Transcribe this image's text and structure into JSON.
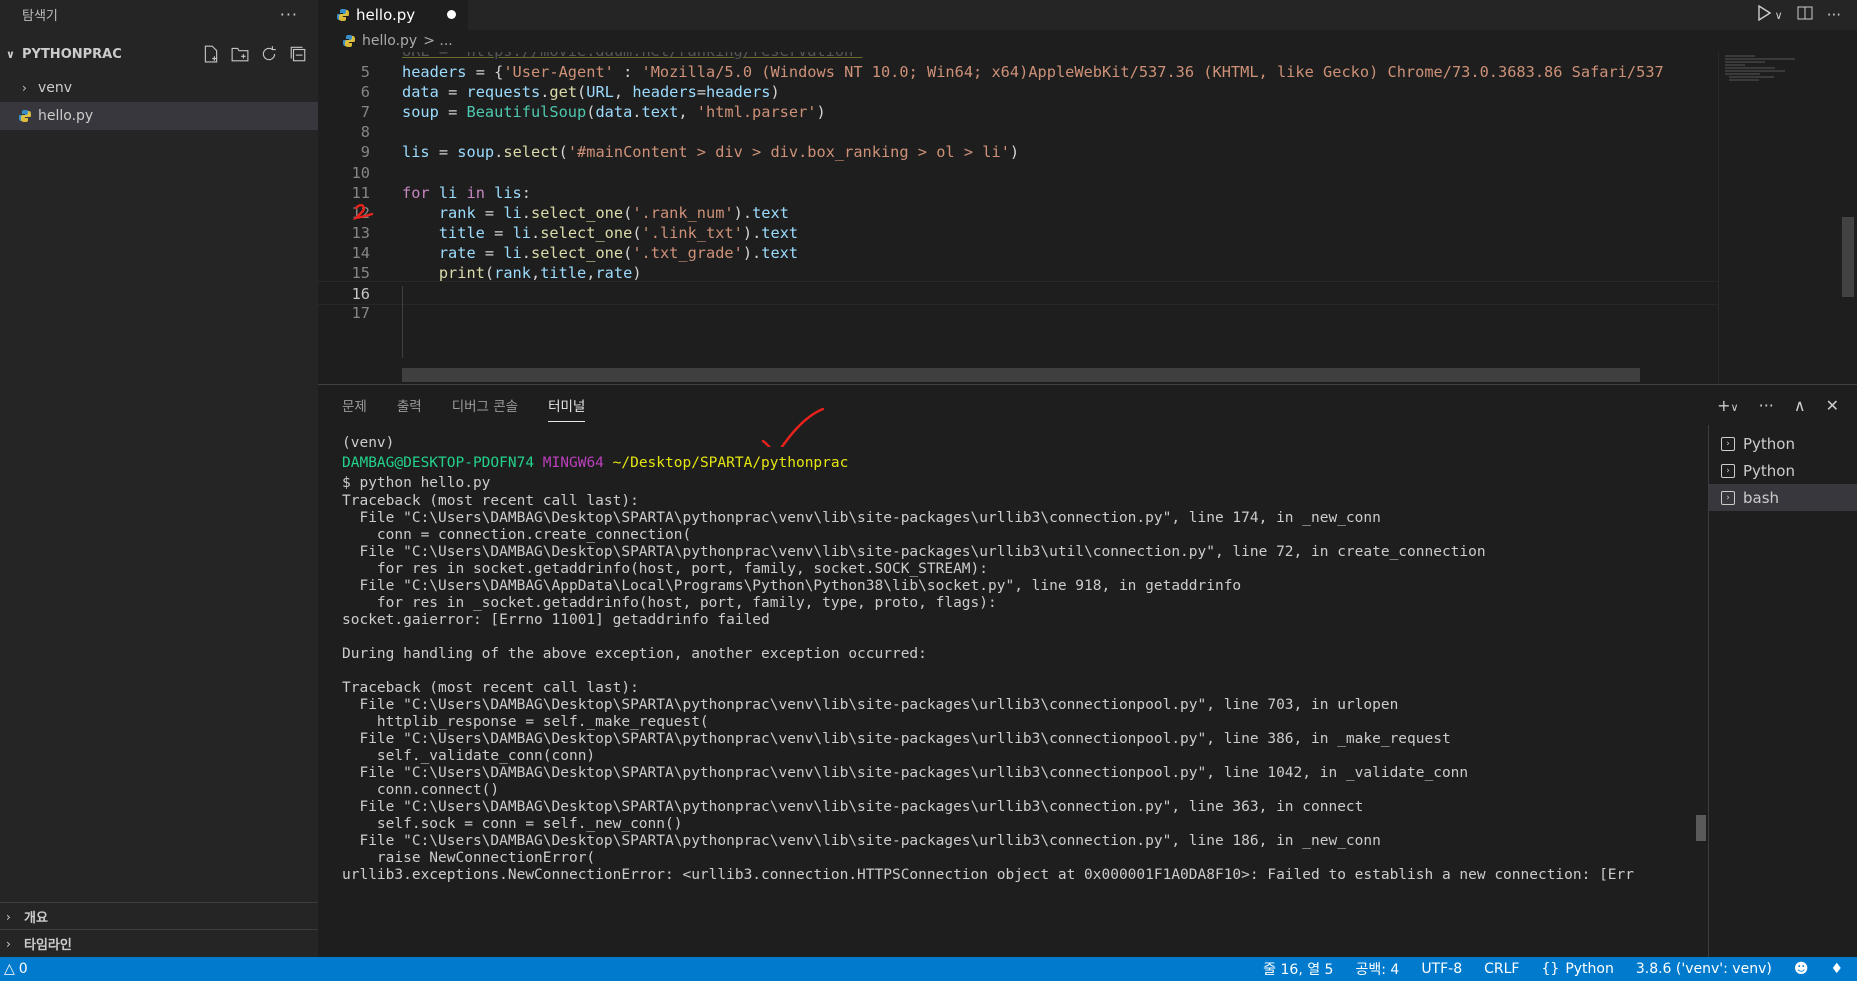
{
  "sidebar": {
    "title": "탐색기",
    "more": "···",
    "section": "PYTHONPRAC",
    "items": [
      {
        "label": "venv",
        "type": "folder"
      },
      {
        "label": "hello.py",
        "type": "file"
      }
    ],
    "bottom": [
      {
        "label": "개요"
      },
      {
        "label": "타임라인"
      }
    ]
  },
  "editor": {
    "tab": "hello.py",
    "breadcrumb_file": "hello.py",
    "breadcrumb_rest": "> ...",
    "cut_line": "URL = 'https://movie.daum.net/ranking/reservation'",
    "lines": [
      {
        "n": "5",
        "code": "headers = {'User-Agent' : 'Mozilla/5.0 (Windows NT 10.0; Win64; x64)AppleWebKit/537.36 (KHTML, like Gecko) Chrome/73.0.3683.86 Safari/537"
      },
      {
        "n": "6",
        "code": "data = requests.get(URL, headers=headers)"
      },
      {
        "n": "7",
        "code": "soup = BeautifulSoup(data.text, 'html.parser')"
      },
      {
        "n": "8",
        "code": ""
      },
      {
        "n": "9",
        "code": "lis = soup.select('#mainContent > div > div.box_ranking > ol > li')"
      },
      {
        "n": "10",
        "code": ""
      },
      {
        "n": "11",
        "code": "for li in lis:"
      },
      {
        "n": "12",
        "code": "    rank = li.select_one('.rank_num').text"
      },
      {
        "n": "13",
        "code": "    title = li.select_one('.link_txt').text"
      },
      {
        "n": "14",
        "code": "    rate = li.select_one('.txt_grade').text"
      },
      {
        "n": "15",
        "code": "    print(rank,title,rate)"
      },
      {
        "n": "16",
        "code": ""
      },
      {
        "n": "17",
        "code": ""
      }
    ]
  },
  "panel": {
    "tabs": [
      "문제",
      "출력",
      "디버그 콘솔",
      "터미널"
    ],
    "active_tab": "터미널",
    "terminal": {
      "venv": "(venv)",
      "prompt_user": "DAMBAG@DESKTOP-PDOFN74",
      "prompt_host": "MINGW64",
      "prompt_path": "~/Desktop/SPARTA/pythonprac",
      "command": "$ python hello.py",
      "output": [
        "Traceback (most recent call last):",
        "  File \"C:\\Users\\DAMBAG\\Desktop\\SPARTA\\pythonprac\\venv\\lib\\site-packages\\urllib3\\connection.py\", line 174, in _new_conn",
        "    conn = connection.create_connection(",
        "  File \"C:\\Users\\DAMBAG\\Desktop\\SPARTA\\pythonprac\\venv\\lib\\site-packages\\urllib3\\util\\connection.py\", line 72, in create_connection",
        "    for res in socket.getaddrinfo(host, port, family, socket.SOCK_STREAM):",
        "  File \"C:\\Users\\DAMBAG\\AppData\\Local\\Programs\\Python\\Python38\\lib\\socket.py\", line 918, in getaddrinfo",
        "    for res in _socket.getaddrinfo(host, port, family, type, proto, flags):",
        "socket.gaierror: [Errno 11001] getaddrinfo failed",
        "",
        "During handling of the above exception, another exception occurred:",
        "",
        "Traceback (most recent call last):",
        "  File \"C:\\Users\\DAMBAG\\Desktop\\SPARTA\\pythonprac\\venv\\lib\\site-packages\\urllib3\\connectionpool.py\", line 703, in urlopen",
        "    httplib_response = self._make_request(",
        "  File \"C:\\Users\\DAMBAG\\Desktop\\SPARTA\\pythonprac\\venv\\lib\\site-packages\\urllib3\\connectionpool.py\", line 386, in _make_request",
        "    self._validate_conn(conn)",
        "  File \"C:\\Users\\DAMBAG\\Desktop\\SPARTA\\pythonprac\\venv\\lib\\site-packages\\urllib3\\connectionpool.py\", line 1042, in _validate_conn",
        "    conn.connect()",
        "  File \"C:\\Users\\DAMBAG\\Desktop\\SPARTA\\pythonprac\\venv\\lib\\site-packages\\urllib3\\connection.py\", line 363, in connect",
        "    self.sock = conn = self._new_conn()",
        "  File \"C:\\Users\\DAMBAG\\Desktop\\SPARTA\\pythonprac\\venv\\lib\\site-packages\\urllib3\\connection.py\", line 186, in _new_conn",
        "    raise NewConnectionError(",
        "urllib3.exceptions.NewConnectionError: <urllib3.connection.HTTPSConnection object at 0x000001F1A0DA8F10>: Failed to establish a new connection: [Err"
      ]
    },
    "terminals": [
      {
        "label": "Python"
      },
      {
        "label": "Python"
      },
      {
        "label": "bash"
      }
    ]
  },
  "statusbar": {
    "warnings": "0",
    "position": "줄 16, 열 5",
    "spaces": "공백: 4",
    "encoding": "UTF-8",
    "eol": "CRLF",
    "language": "Python",
    "interpreter": "3.8.6 ('venv': venv)"
  },
  "colors": {
    "accent": "#007acc",
    "sidebar_bg": "#252526",
    "editor_bg": "#1e1e1e",
    "annotation_red": "#e8231b"
  }
}
